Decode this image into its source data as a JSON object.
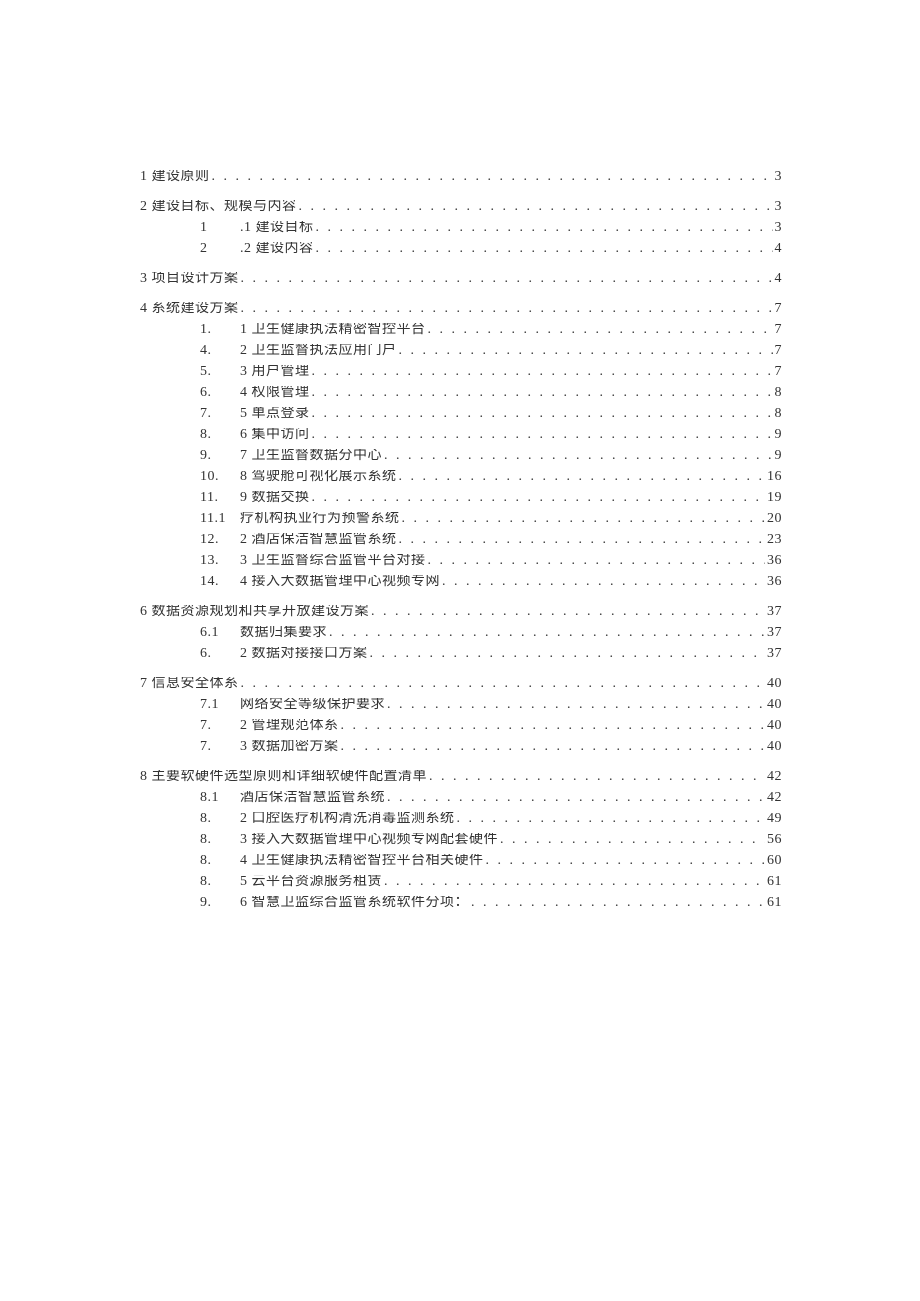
{
  "toc": [
    {
      "level": 1,
      "num": "1",
      "title": "建设原则",
      "page": "3"
    },
    {
      "level": 1,
      "num": "2",
      "title": "建设目标、规模与内容",
      "page": "3"
    },
    {
      "level": 2,
      "num": "1",
      "title": ".1 建设目标",
      "page": "3"
    },
    {
      "level": 2,
      "num": "2",
      "title": ".2 建设内容",
      "page": "4"
    },
    {
      "level": 1,
      "num": "3",
      "title": "项目设计方案",
      "page": "4"
    },
    {
      "level": 1,
      "num": "4",
      "title": "系统建设方案",
      "page": "7"
    },
    {
      "level": 2,
      "num": "1.",
      "title": "1 卫生健康执法精密智控平台",
      "page": "7"
    },
    {
      "level": 2,
      "num": "4.",
      "title": "2 卫生监督执法应用门户",
      "page": "7"
    },
    {
      "level": 2,
      "num": "5.",
      "title": "3 用户管理",
      "page": "7"
    },
    {
      "level": 2,
      "num": "6.",
      "title": "4 权限管理",
      "page": "8"
    },
    {
      "level": 2,
      "num": "7.",
      "title": "5 单点登录",
      "page": "8"
    },
    {
      "level": 2,
      "num": "8.",
      "title": "6 集中访问",
      "page": "9"
    },
    {
      "level": 2,
      "num": "9.",
      "title": "7 卫生监督数据分中心",
      "page": "9"
    },
    {
      "level": 2,
      "num": "10.",
      "title": "8 驾驶舱可视化展示系统",
      "page": "16"
    },
    {
      "level": 2,
      "num": "11.",
      "title": "9 数据交换",
      "page": "19"
    },
    {
      "level": 2,
      "num": "11.1",
      "title": "   疗机构执业行为预警系统",
      "page": "20"
    },
    {
      "level": 2,
      "num": "12.",
      "title": "2 酒店保洁智慧监管系统",
      "page": "23"
    },
    {
      "level": 2,
      "num": "13.",
      "title": "3 卫生监督综合监管平台对接",
      "page": "36"
    },
    {
      "level": 2,
      "num": "14.",
      "title": "4 接入大数据管理中心视频专网",
      "page": "36"
    },
    {
      "level": 1,
      "num": "6",
      "title": "数据资源规划和共享开放建设方案",
      "page": "37"
    },
    {
      "level": 2,
      "num": "6.1",
      "title": "   数据归集要求",
      "page": "37"
    },
    {
      "level": 2,
      "num": "6.",
      "title": "2 数据对接接口方案",
      "page": "37"
    },
    {
      "level": 1,
      "num": "7",
      "title": "信息安全体系",
      "page": "40"
    },
    {
      "level": 2,
      "num": "7.1",
      "title": "网络安全等级保护要求",
      "page": "40"
    },
    {
      "level": 2,
      "num": "7.",
      "title": "2 管理规范体系",
      "page": "40"
    },
    {
      "level": 2,
      "num": "7.",
      "title": "3 数据加密方案",
      "page": "40"
    },
    {
      "level": 1,
      "num": "8",
      "title": "主要软硬件选型原则和详细软硬件配置清单",
      "page": "42"
    },
    {
      "level": 2,
      "num": "8.1",
      "title": "酒店保洁智慧监管系统",
      "page": "42"
    },
    {
      "level": 2,
      "num": "8.",
      "title": "2 口腔医疗机构清洗消毒监测系统",
      "page": "49"
    },
    {
      "level": 2,
      "num": "8.",
      "title": "3 接入大数据管理中心视频专网配套硬件",
      "page": "56"
    },
    {
      "level": 2,
      "num": "8.",
      "title": "4 卫生健康执法精密智控平台相关硬件",
      "page": "60"
    },
    {
      "level": 2,
      "num": "8.",
      "title": "5 云平台资源服务租赁",
      "page": "61"
    },
    {
      "level": 2,
      "num": "9.",
      "title": "6 智慧卫监综合监管系统软件分项：",
      "page": "61"
    }
  ]
}
